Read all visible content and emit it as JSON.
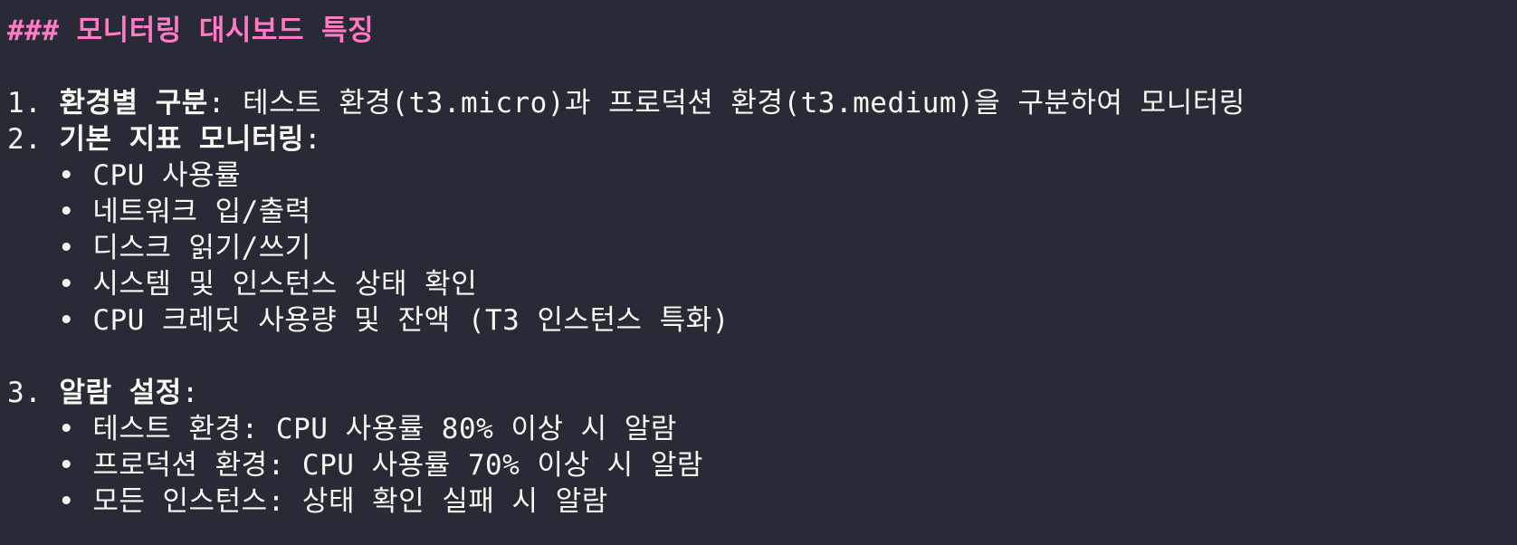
{
  "heading": "### 모니터링 대시보드 특징",
  "sections": [
    {
      "number": "1.",
      "title": "환경별 구분",
      "suffix": ": 테스트 환경(t3.micro)과 프로덕션 환경(t3.medium)을 구분하여 모니터링",
      "bullets": []
    },
    {
      "number": "2.",
      "title": "기본 지표 모니터링",
      "suffix": ":",
      "bullets": [
        "• CPU 사용률",
        "• 네트워크 입/출력",
        "• 디스크 읽기/쓰기",
        "• 시스템 및 인스턴스 상태 확인",
        "• CPU 크레딧 사용량 및 잔액 (T3 인스턴스 특화)"
      ]
    },
    {
      "number": "3.",
      "title": "알람 설정",
      "suffix": ":",
      "bullets": [
        "• 테스트 환경: CPU 사용률 80% 이상 시 알람",
        "• 프로덕션 환경: CPU 사용률 70% 이상 시 알람",
        "• 모든 인스턴스: 상태 확인 실패 시 알람"
      ]
    }
  ]
}
